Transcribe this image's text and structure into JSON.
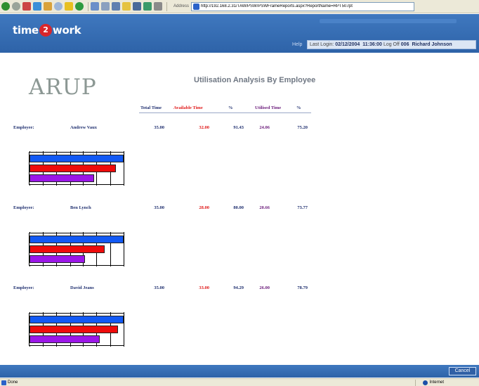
{
  "browser": {
    "address_label": "Address",
    "url": "http://192.168.2.31/TAW/PSW/PSWFrameReports.aspx?ReportName=RPT50.rpt",
    "go_label": "Go",
    "status_text": "Done",
    "zone_text": "Internet"
  },
  "app": {
    "logo_left": "time",
    "logo_badge": "2",
    "logo_right": "work",
    "help_label": "Help",
    "login_prefix": "Last Login:",
    "login_date": "02/12/2004",
    "login_time": "11:36:00",
    "logoff_label": "Log Off",
    "user_id": "006",
    "user_name": "Richard Johnson",
    "cancel_label": "Cancel"
  },
  "report": {
    "company": "ARUP",
    "title": "Utilisation Analysis By Employee",
    "columns": {
      "total_time": "Total Time",
      "available_time": "Available Time",
      "avail_pct": "%",
      "utilised_time": "Utilised Time",
      "util_pct": "%"
    },
    "employee_label": "Employee:",
    "employees": [
      {
        "name": "Andrew Vaux",
        "total": "35.00",
        "available": "32.00",
        "avail_pct": "91.43",
        "utilised": "24.06",
        "util_pct": "75.20",
        "bar_total": 35.0,
        "bar_available": 32.0,
        "bar_utilised": 24.06
      },
      {
        "name": "Ben Lynch",
        "total": "35.00",
        "available": "28.00",
        "avail_pct": "80.00",
        "utilised": "20.66",
        "util_pct": "73.77",
        "bar_total": 35.0,
        "bar_available": 28.0,
        "bar_utilised": 20.66
      },
      {
        "name": "David Jeans",
        "total": "35.00",
        "available": "33.00",
        "avail_pct": "94.29",
        "utilised": "26.00",
        "util_pct": "78.79",
        "bar_total": 35.0,
        "bar_available": 33.0,
        "bar_utilised": 26.0
      }
    ]
  },
  "colors": {
    "header_blue": "#2e63a8",
    "total_bar": "#1259f4",
    "available_bar": "#ee0b0b",
    "utilised_bar": "#9b16e8",
    "label_navy": "#1f2f6f",
    "available_red": "#e01919",
    "utilised_purple": "#6a1a7a"
  }
}
